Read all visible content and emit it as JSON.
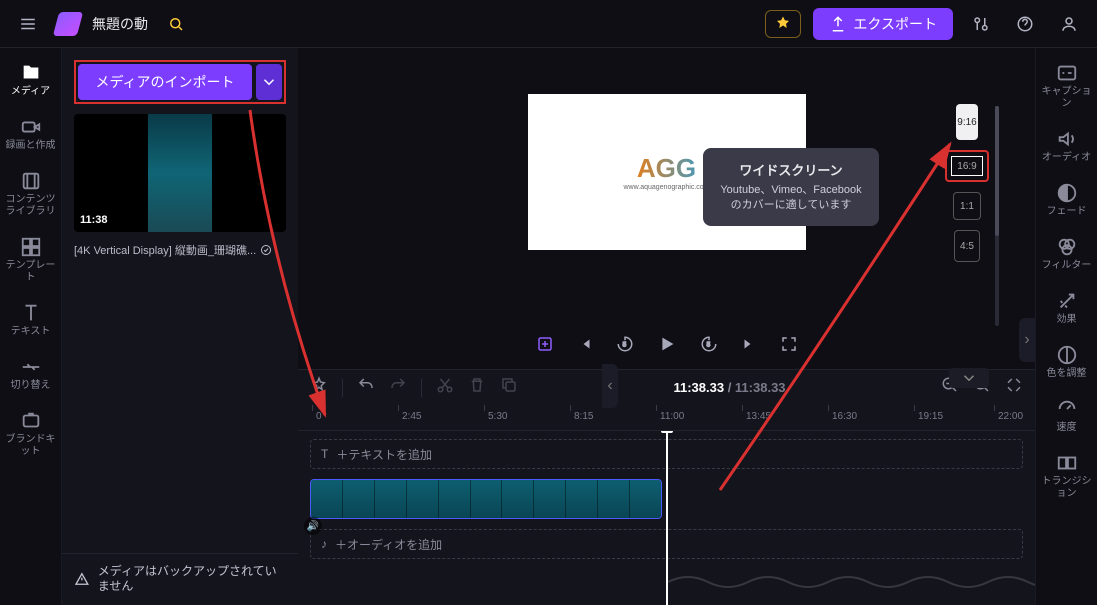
{
  "header": {
    "title": "無題の動",
    "export_label": "エクスポート"
  },
  "leftnav": {
    "media": "メディア",
    "record": "録画と作成",
    "library": "コンテンツライブラリ",
    "templates": "テンプレート",
    "text": "テキスト",
    "transitions": "切り替え",
    "brandkit": "ブランドキット"
  },
  "media": {
    "import_label": "メディアのインポート",
    "thumb_duration": "11:38",
    "thumb_caption": "[4K Vertical Display] 縦動画_珊瑚礁...",
    "backup_msg": "メディアはバックアップされていません"
  },
  "tooltip": {
    "title": "ワイドスクリーン",
    "body": "Youtube、Vimeo、Facebook のカバーに適しています"
  },
  "ratios": {
    "r916": "9:16",
    "r169": "16:9",
    "r11": "1:1",
    "r45": "4:5"
  },
  "timeline": {
    "current": "11:38.33",
    "total": "11:38.33",
    "ticks": [
      "0",
      "2:45",
      "5:30",
      "8:15",
      "11:00",
      "13:45",
      "16:30",
      "19:15",
      "22:00"
    ],
    "add_text": "＋テキストを追加",
    "add_audio": "＋オーディオを追加"
  },
  "rightnav": {
    "captions": "キャプション",
    "audio": "オーディオ",
    "fade": "フェード",
    "filters": "フィルター",
    "effects": "効果",
    "color": "色を調整",
    "speed": "速度",
    "trans": "トランジション"
  }
}
